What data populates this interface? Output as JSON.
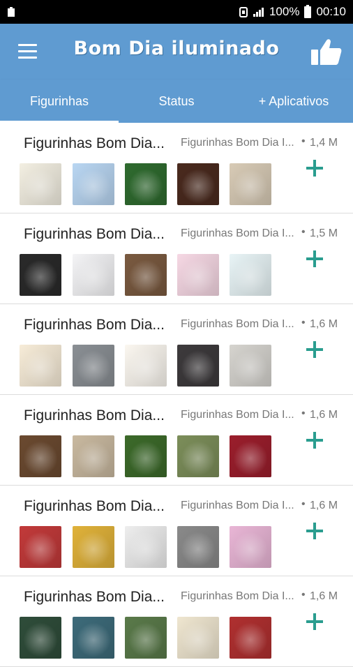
{
  "status_bar": {
    "battery": "100%",
    "time": "00:10"
  },
  "app_bar": {
    "title": "Bom Dia iluminado",
    "menu_icon": "hamburger-menu-icon",
    "like_icon": "thumbs-up-icon"
  },
  "tabs": [
    {
      "label": "Figurinhas",
      "active": true
    },
    {
      "label": "Status",
      "active": false
    },
    {
      "label": "+ Aplicativos",
      "active": false
    }
  ],
  "colors": {
    "primary": "#5f9bd1",
    "accent": "#2a9d8f"
  },
  "packs": [
    {
      "title": "Figurinhas Bom Dia...",
      "author": "Figurinhas Bom Dia I...",
      "size": "1,4 M",
      "thumbs": [
        "#f3efe2",
        "#b9d6f2",
        "#2f6b2f",
        "#4a2a1e",
        "#d8cbb6"
      ]
    },
    {
      "title": "Figurinhas Bom Dia...",
      "author": "Figurinhas Bom Dia I...",
      "size": "1,5 M",
      "thumbs": [
        "#2a2a2a",
        "#f4f4f6",
        "#7a5a40",
        "#f6d8e4",
        "#e8f4f6"
      ]
    },
    {
      "title": "Figurinhas Bom Dia...",
      "author": "Figurinhas Bom Dia I...",
      "size": "1,6 M",
      "thumbs": [
        "#f7ecd8",
        "#8a8f94",
        "#fbf7f0",
        "#3d3a3c",
        "#d6d4cf"
      ]
    },
    {
      "title": "Figurinhas Bom Dia...",
      "author": "Figurinhas Bom Dia I...",
      "size": "1,6 M",
      "thumbs": [
        "#6b4a30",
        "#c9b9a0",
        "#3c6a2a",
        "#7c8e5a",
        "#9b1e2c"
      ]
    },
    {
      "title": "Figurinhas Bom Dia...",
      "author": "Figurinhas Bom Dia I...",
      "size": "1,6 M",
      "thumbs": [
        "#c23a3a",
        "#e0b23a",
        "#eeeeee",
        "#8a8a8a",
        "#e9b6d6"
      ]
    },
    {
      "title": "Figurinhas Bom Dia...",
      "author": "Figurinhas Bom Dia I...",
      "size": "1,6 M",
      "thumbs": [
        "#2f4d3a",
        "#3d6b7a",
        "#5a7a4a",
        "#efe6d0",
        "#b03030"
      ]
    }
  ]
}
